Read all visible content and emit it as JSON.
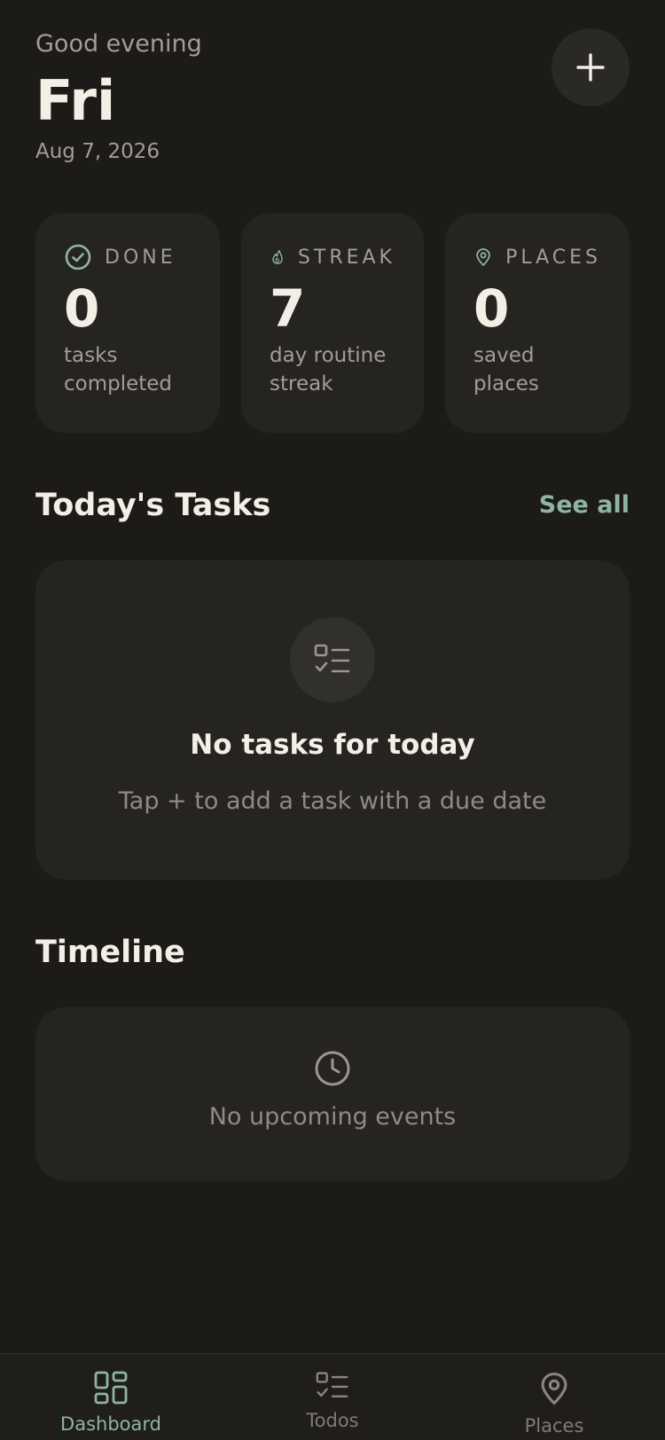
{
  "header": {
    "greeting": "Good evening",
    "day": "Fri",
    "date": "Aug 7, 2026",
    "add_icon": "plus-icon"
  },
  "stats": [
    {
      "icon": "check-circle-icon",
      "label": "DONE",
      "value": "0",
      "desc_line1": "tasks",
      "desc_line2": "completed"
    },
    {
      "icon": "flame-icon",
      "label": "STREAK",
      "value": "7",
      "desc_line1": "day routine",
      "desc_line2": "streak"
    },
    {
      "icon": "map-pin-icon",
      "label": "PLACES",
      "value": "0",
      "desc_line1": "saved places",
      "desc_line2": ""
    }
  ],
  "tasks_section": {
    "title": "Today's Tasks",
    "see_all": "See all",
    "empty_icon": "checklist-icon",
    "empty_title": "No tasks for today",
    "empty_subtitle": "Tap + to add a task with a due date"
  },
  "timeline_section": {
    "title": "Timeline",
    "empty_icon": "clock-icon",
    "empty_text": "No upcoming events"
  },
  "nav": {
    "items": [
      {
        "icon": "grid-icon",
        "label": "Dashboard",
        "active": true
      },
      {
        "icon": "checklist-icon",
        "label": "Todos",
        "active": false
      },
      {
        "icon": "map-pin-icon",
        "label": "Places",
        "active": false
      }
    ]
  },
  "colors": {
    "background": "#1c1b18",
    "card": "#252421",
    "accent": "#8fb5a0",
    "muted_text": "#a29e94"
  }
}
